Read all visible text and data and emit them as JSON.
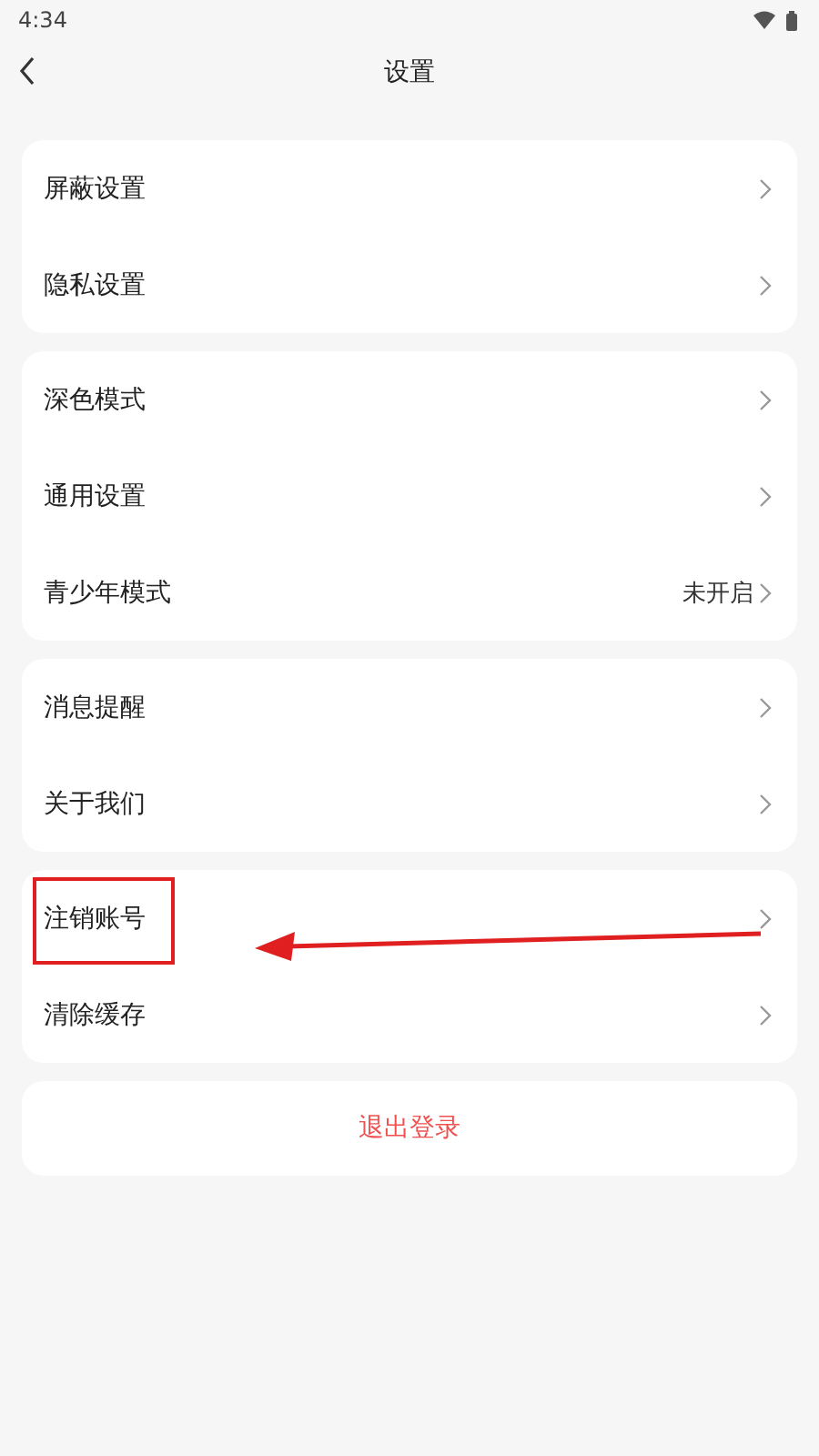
{
  "status_bar": {
    "time": "4:34"
  },
  "header": {
    "title": "设置"
  },
  "groups": [
    {
      "items": [
        {
          "label": "屏蔽设置",
          "highlighted": false
        },
        {
          "label": "隐私设置",
          "highlighted": false
        }
      ]
    },
    {
      "items": [
        {
          "label": "深色模式",
          "highlighted": false
        },
        {
          "label": "通用设置",
          "highlighted": false
        },
        {
          "label": "青少年模式",
          "value": "未开启",
          "highlighted": false
        }
      ]
    },
    {
      "items": [
        {
          "label": "消息提醒",
          "highlighted": false
        },
        {
          "label": "关于我们",
          "highlighted": false
        }
      ]
    },
    {
      "items": [
        {
          "label": "注销账号",
          "highlighted": true
        },
        {
          "label": "清除缓存",
          "highlighted": false
        }
      ]
    }
  ],
  "logout": {
    "label": "退出登录"
  }
}
